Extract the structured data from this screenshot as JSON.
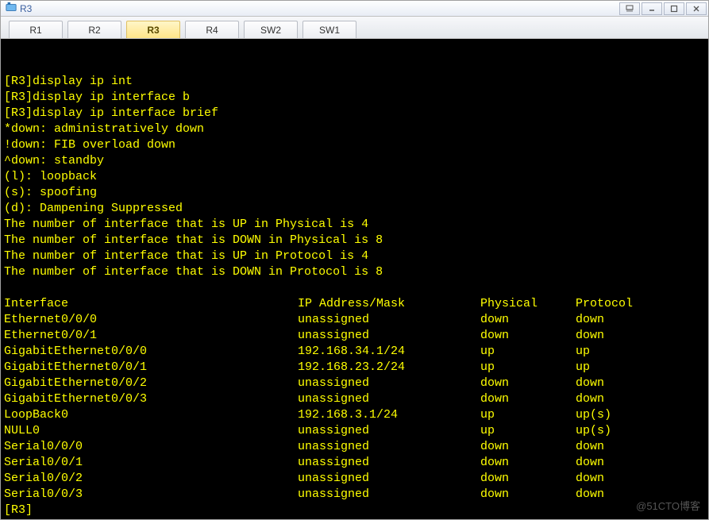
{
  "window": {
    "title": "R3"
  },
  "tabs": [
    {
      "label": "R1",
      "active": false
    },
    {
      "label": "R2",
      "active": false
    },
    {
      "label": "R3",
      "active": true
    },
    {
      "label": "R4",
      "active": false
    },
    {
      "label": "SW2",
      "active": false
    },
    {
      "label": "SW1",
      "active": false
    }
  ],
  "terminal": {
    "pre_lines": [
      "[R3]display ip int",
      "[R3]display ip interface b",
      "[R3]display ip interface brief",
      "*down: administratively down",
      "!down: FIB overload down",
      "^down: standby",
      "(l): loopback",
      "(s): spoofing",
      "(d): Dampening Suppressed",
      "The number of interface that is UP in Physical is 4",
      "The number of interface that is DOWN in Physical is 8",
      "The number of interface that is UP in Protocol is 4",
      "The number of interface that is DOWN in Protocol is 8",
      ""
    ],
    "header": {
      "col1": "Interface",
      "col2": "IP Address/Mask",
      "col3": "Physical",
      "col4": "Protocol"
    },
    "rows": [
      {
        "if": "Ethernet0/0/0",
        "ip": "unassigned",
        "phy": "down",
        "prot": "down"
      },
      {
        "if": "Ethernet0/0/1",
        "ip": "unassigned",
        "phy": "down",
        "prot": "down"
      },
      {
        "if": "GigabitEthernet0/0/0",
        "ip": "192.168.34.1/24",
        "phy": "up",
        "prot": "up"
      },
      {
        "if": "GigabitEthernet0/0/1",
        "ip": "192.168.23.2/24",
        "phy": "up",
        "prot": "up"
      },
      {
        "if": "GigabitEthernet0/0/2",
        "ip": "unassigned",
        "phy": "down",
        "prot": "down"
      },
      {
        "if": "GigabitEthernet0/0/3",
        "ip": "unassigned",
        "phy": "down",
        "prot": "down"
      },
      {
        "if": "LoopBack0",
        "ip": "192.168.3.1/24",
        "phy": "up",
        "prot": "up(s)"
      },
      {
        "if": "NULL0",
        "ip": "unassigned",
        "phy": "up",
        "prot": "up(s)"
      },
      {
        "if": "Serial0/0/0",
        "ip": "unassigned",
        "phy": "down",
        "prot": "down"
      },
      {
        "if": "Serial0/0/1",
        "ip": "unassigned",
        "phy": "down",
        "prot": "down"
      },
      {
        "if": "Serial0/0/2",
        "ip": "unassigned",
        "phy": "down",
        "prot": "down"
      },
      {
        "if": "Serial0/0/3",
        "ip": "unassigned",
        "phy": "down",
        "prot": "down"
      }
    ],
    "prompt": "[R3]"
  },
  "watermark": "@51CTO博客"
}
